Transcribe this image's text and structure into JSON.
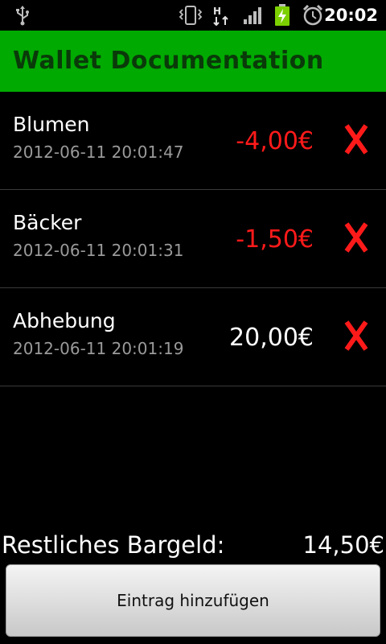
{
  "status_bar": {
    "time": "20:02",
    "icons": [
      "usb-icon",
      "vibrate-icon",
      "hspa-data-icon",
      "signal-icon",
      "battery-charging-icon",
      "alarm-icon"
    ]
  },
  "app": {
    "title": "Wallet Documentation",
    "title_bar_color": "#00aa00"
  },
  "entries": [
    {
      "name": "Blumen",
      "timestamp": "2012-06-11 20:01:47",
      "amount": "-4,00€",
      "sign": "negative",
      "delete_label": "X"
    },
    {
      "name": "Bäcker",
      "timestamp": "2012-06-11 20:01:31",
      "amount": "-1,50€",
      "sign": "negative",
      "delete_label": "X"
    },
    {
      "name": "Abhebung",
      "timestamp": "2012-06-11 20:01:19",
      "amount": "20,00€",
      "sign": "positive",
      "delete_label": "X"
    }
  ],
  "footer": {
    "balance_label": "Restliches Bargeld:",
    "balance_value": "14,50€",
    "add_button_label": "Eintrag hinzufügen"
  },
  "colors": {
    "negative_amount": "#ff1a1a",
    "positive_amount": "#ffffff",
    "delete": "#ff1a1a"
  }
}
